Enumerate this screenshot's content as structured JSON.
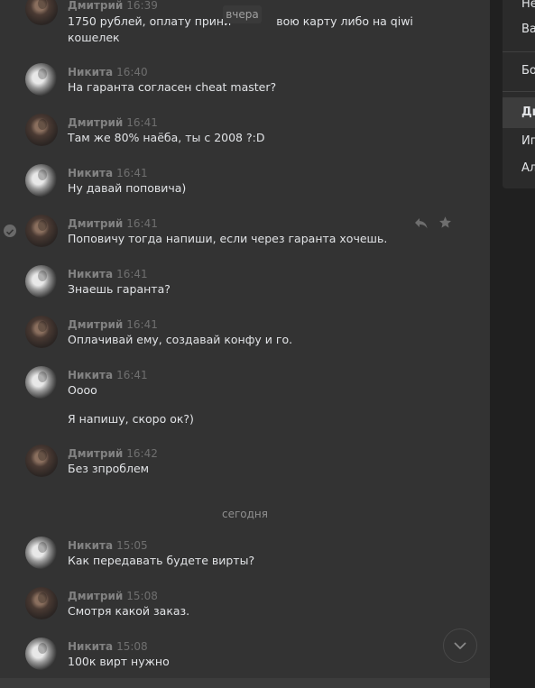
{
  "right_menu": {
    "items": [
      {
        "label": "Неп"
      },
      {
        "label": "Важ"
      },
      {
        "label": "Бот"
      },
      {
        "label": "Дми"
      },
      {
        "label": "Игр"
      },
      {
        "label": "Ал"
      }
    ]
  },
  "dates": {
    "yesterday": "вчера",
    "today": "сегодня"
  },
  "messages": [
    {
      "author": "Дмитрий",
      "time": "16:39",
      "text": "1750 рублей, оплату прини",
      "text2": "вою карту либо на qiwi",
      "text3": "кошелек"
    },
    {
      "author": "Никита",
      "time": "16:40",
      "text": "На гаранта согласен cheat master?"
    },
    {
      "author": "Дмитрий",
      "time": "16:41",
      "text": "Там же 80% наёба, ты с 2008 ?:D"
    },
    {
      "author": "Никита",
      "time": "16:41",
      "text": "Ну давай поповича)"
    },
    {
      "author": "Дмитрий",
      "time": "16:41",
      "text": "Поповичу тогда напиши, если через гаранта хочешь."
    },
    {
      "author": "Никита",
      "time": "16:41",
      "text": "Знаешь гаранта?"
    },
    {
      "author": "Дмитрий",
      "time": "16:41",
      "text": "Оплачивай ему, создавай конфу и го."
    },
    {
      "author": "Никита",
      "time": "16:41",
      "text": "Оооо",
      "text2": "Я напишу, скоро ок?)"
    },
    {
      "author": "Дмитрий",
      "time": "16:42",
      "text": "Без зпроблем"
    },
    {
      "author": "Никита",
      "time": "15:05",
      "text": "Как передавать будете вирты?"
    },
    {
      "author": "Дмитрий",
      "time": "15:08",
      "text": "Смотря какой заказ."
    },
    {
      "author": "Никита",
      "time": "15:08",
      "text": "100к вирт нужно"
    }
  ]
}
